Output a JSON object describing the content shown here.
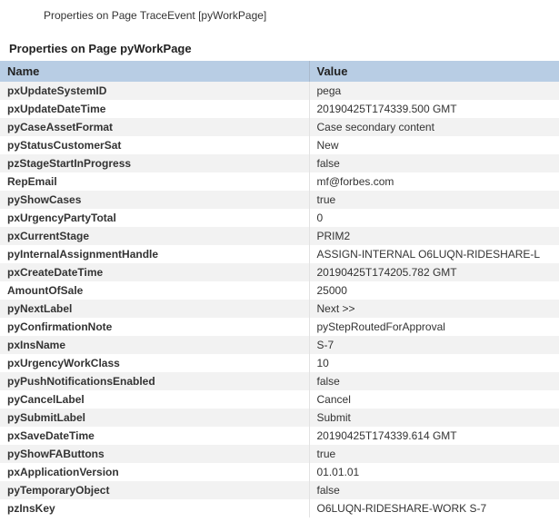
{
  "title": "Properties on Page TraceEvent [pyWorkPage]",
  "section_title": "Properties on Page pyWorkPage",
  "columns": {
    "name": "Name",
    "value": "Value"
  },
  "rows": [
    {
      "name": "pxUpdateSystemID",
      "value": "pega"
    },
    {
      "name": "pxUpdateDateTime",
      "value": "20190425T174339.500 GMT"
    },
    {
      "name": "pyCaseAssetFormat",
      "value": "Case secondary content"
    },
    {
      "name": "pyStatusCustomerSat",
      "value": "New"
    },
    {
      "name": "pzStageStartInProgress",
      "value": "false"
    },
    {
      "name": "RepEmail",
      "value": "mf@forbes.com"
    },
    {
      "name": "pyShowCases",
      "value": "true"
    },
    {
      "name": "pxUrgencyPartyTotal",
      "value": "0"
    },
    {
      "name": "pxCurrentStage",
      "value": "PRIM2"
    },
    {
      "name": "pyInternalAssignmentHandle",
      "value": "ASSIGN-INTERNAL O6LUQN-RIDESHARE-L"
    },
    {
      "name": "pxCreateDateTime",
      "value": "20190425T174205.782 GMT"
    },
    {
      "name": "AmountOfSale",
      "value": "25000"
    },
    {
      "name": "pyNextLabel",
      "value": "Next >>"
    },
    {
      "name": "pyConfirmationNote",
      "value": "pyStepRoutedForApproval"
    },
    {
      "name": "pxInsName",
      "value": "S-7"
    },
    {
      "name": "pxUrgencyWorkClass",
      "value": "10"
    },
    {
      "name": "pyPushNotificationsEnabled",
      "value": "false"
    },
    {
      "name": "pyCancelLabel",
      "value": "Cancel"
    },
    {
      "name": "pySubmitLabel",
      "value": "Submit"
    },
    {
      "name": "pxSaveDateTime",
      "value": "20190425T174339.614 GMT"
    },
    {
      "name": "pyShowFAButtons",
      "value": "true"
    },
    {
      "name": "pxApplicationVersion",
      "value": "01.01.01"
    },
    {
      "name": "pyTemporaryObject",
      "value": "false"
    },
    {
      "name": "pzInsKey",
      "value": "O6LUQN-RIDESHARE-WORK S-7"
    }
  ]
}
